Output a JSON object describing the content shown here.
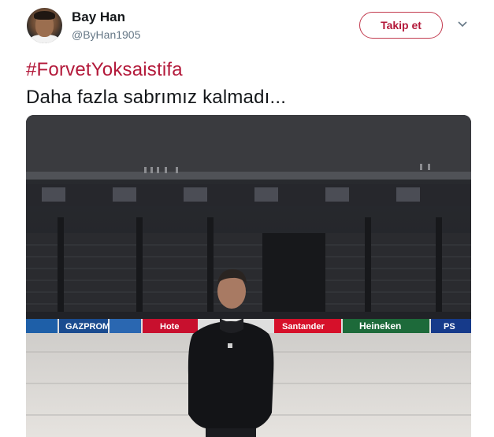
{
  "tweet": {
    "author": {
      "display_name": "Bay Han",
      "handle": "@ByHan1905",
      "avatar_icon": "profile-avatar"
    },
    "follow_label": "Takip et",
    "menu_icon": "chevron-down-icon",
    "hashtag": "#ForvetYoksaistifa",
    "text": "Daha fazla sabrımız kalmadı...",
    "accent_color": "#b3193a"
  },
  "photo": {
    "ad_boards": [
      "GAZPROM",
      "Hote",
      "Santander",
      "Heineken",
      "PS"
    ]
  }
}
